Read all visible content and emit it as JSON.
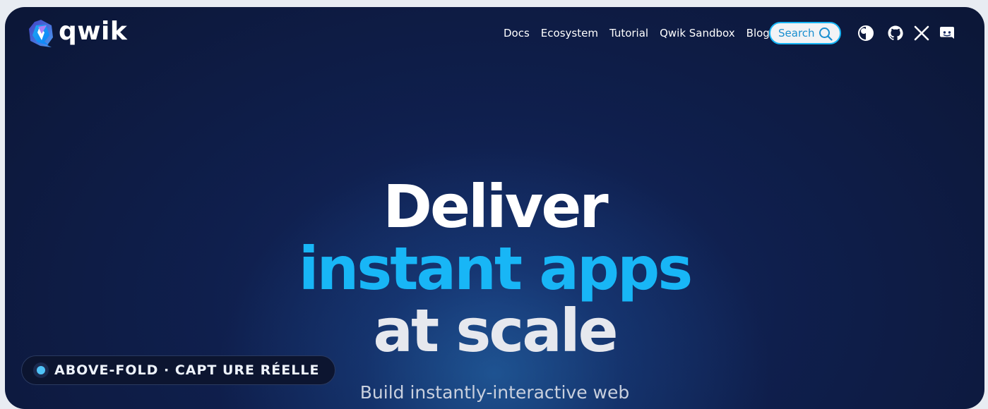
{
  "header": {
    "logo_text": "qwik",
    "nav_items": [
      "Docs",
      "Ecosystem",
      "Tutorial",
      "Qwik Sandbox",
      "Blog"
    ],
    "search_label": "Search",
    "icons": [
      "theme-toggle-icon",
      "github-icon",
      "x-icon",
      "discord-icon"
    ]
  },
  "hero": {
    "line1": "Deliver",
    "line2": "instant apps",
    "line3": "at scale",
    "subtitle": "Build instantly-interactive web"
  },
  "badge": {
    "text": "ABOVE-FOLD · CAPT URE RÉELLE"
  },
  "colors": {
    "accent": "#18b6f6",
    "background": "#0f1f4d",
    "text": "#ffffff"
  }
}
